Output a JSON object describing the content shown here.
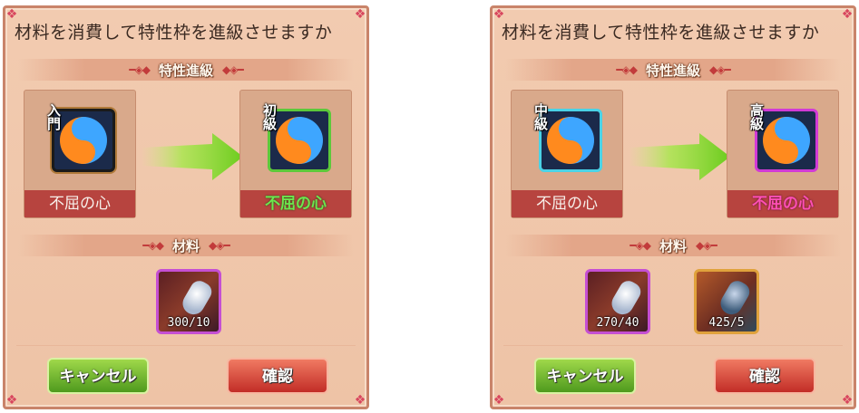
{
  "left_dialog": {
    "title": "材料を消費して特性枠を進級させますか",
    "section_upgrade": "特性進級",
    "section_materials": "材料",
    "from": {
      "grade": "入門",
      "name": "不屈の心",
      "frame": "black"
    },
    "to": {
      "grade": "初級",
      "name": "不屈の心",
      "name_color": "#6ce64e",
      "frame": "green"
    },
    "materials": [
      {
        "count": "300/10",
        "frame_color": "#c54fd3",
        "icon": "potion-bottle-icon"
      }
    ],
    "cancel_label": "キャンセル",
    "confirm_label": "確認"
  },
  "right_dialog": {
    "title": "材料を消費して特性枠を進級させますか",
    "section_upgrade": "特性進級",
    "section_materials": "材料",
    "from": {
      "grade": "中級",
      "name": "不屈の心",
      "frame": "cyan"
    },
    "to": {
      "grade": "高級",
      "name": "不屈の心",
      "name_color": "#ff4fb5",
      "frame": "purple"
    },
    "materials": [
      {
        "count": "270/40",
        "frame_color": "#c54fd3",
        "icon": "potion-bottle-icon"
      },
      {
        "count": "425/5",
        "frame_color": "#e0a23c",
        "icon": "potion-bottle-icon"
      }
    ],
    "cancel_label": "キャンセル",
    "confirm_label": "確認"
  },
  "colors": {
    "panel_bg": "#eec3a6",
    "name_bar": "#b7443f",
    "arrow": "#8be03a",
    "cancel_button": "#4f9a1e",
    "confirm_button": "#c22d27"
  }
}
